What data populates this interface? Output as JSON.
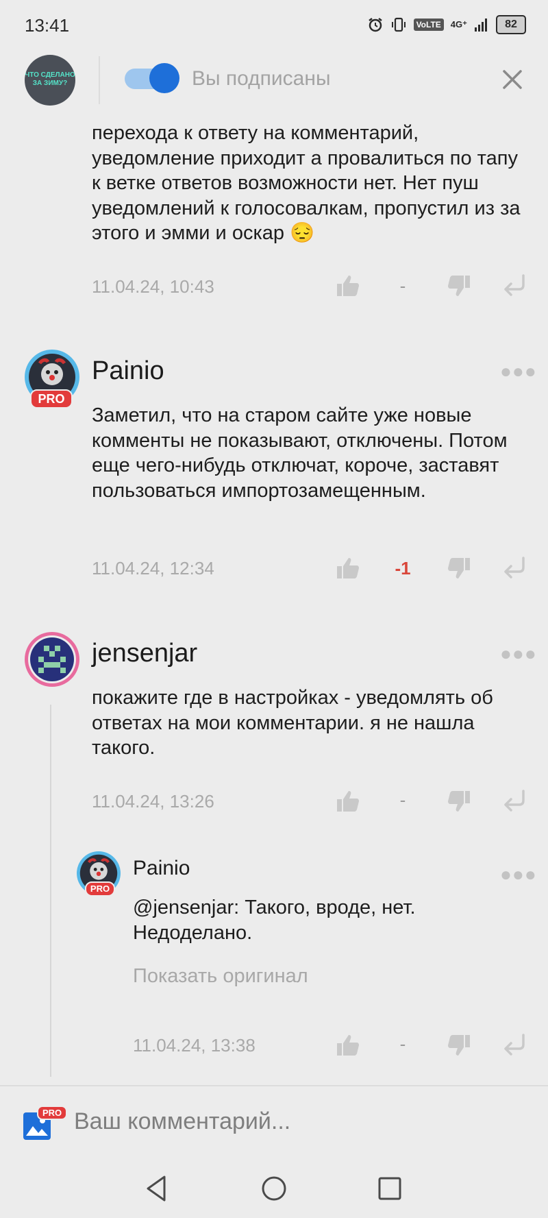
{
  "status_bar": {
    "time": "13:41",
    "network": "4G⁺",
    "volte": "VoLTE",
    "battery": "82"
  },
  "header": {
    "group_avatar_lines": [
      "ЧТО СДЕЛАНО",
      "ЗА ЗИМУ?"
    ],
    "subscribe_label": "Вы подписаны",
    "subscribed": true
  },
  "comments": [
    {
      "text": "перехода к ответу на комментарий, уведомление приходит а провалиться по тапу к ветке ответов возможности нет. Нет пуш уведомлений к голосовалкам, пропустил из за этого и эмми и оскар 😔",
      "timestamp": "11.04.24, 10:43",
      "score": "-"
    },
    {
      "author": "Painio",
      "badge": "PRO",
      "text": "Заметил, что на старом сайте уже новые комменты не показывают, отключены. Потом еще чего-нибудь отключат, короче, заставят пользоваться импортозамещенным.",
      "timestamp": "11.04.24, 12:34",
      "score": "-1"
    },
    {
      "author": "jensenjar",
      "text": "покажите где в настройках - уведомлять об ответах на мои комментарии. я не нашла такого.",
      "timestamp": "11.04.24, 13:26",
      "score": "-"
    },
    {
      "author": "Painio",
      "badge": "PRO",
      "text": "@jensenjar: Такого, вроде, нет. Недоделано.",
      "show_original": "Показать оригинал",
      "timestamp": "11.04.24, 13:38",
      "score": "-"
    }
  ],
  "composer": {
    "placeholder": "Ваш комментарий...",
    "pro_badge": "PRO"
  },
  "icons": {
    "more": "more-dots-icon",
    "like": "thumb-up-icon",
    "dislike": "thumb-down-icon",
    "reply": "reply-icon",
    "close": "close-icon",
    "image": "image-icon"
  },
  "colors": {
    "accent": "#1e6fd9",
    "negative": "#d9463a",
    "pro": "#e23b3b"
  }
}
